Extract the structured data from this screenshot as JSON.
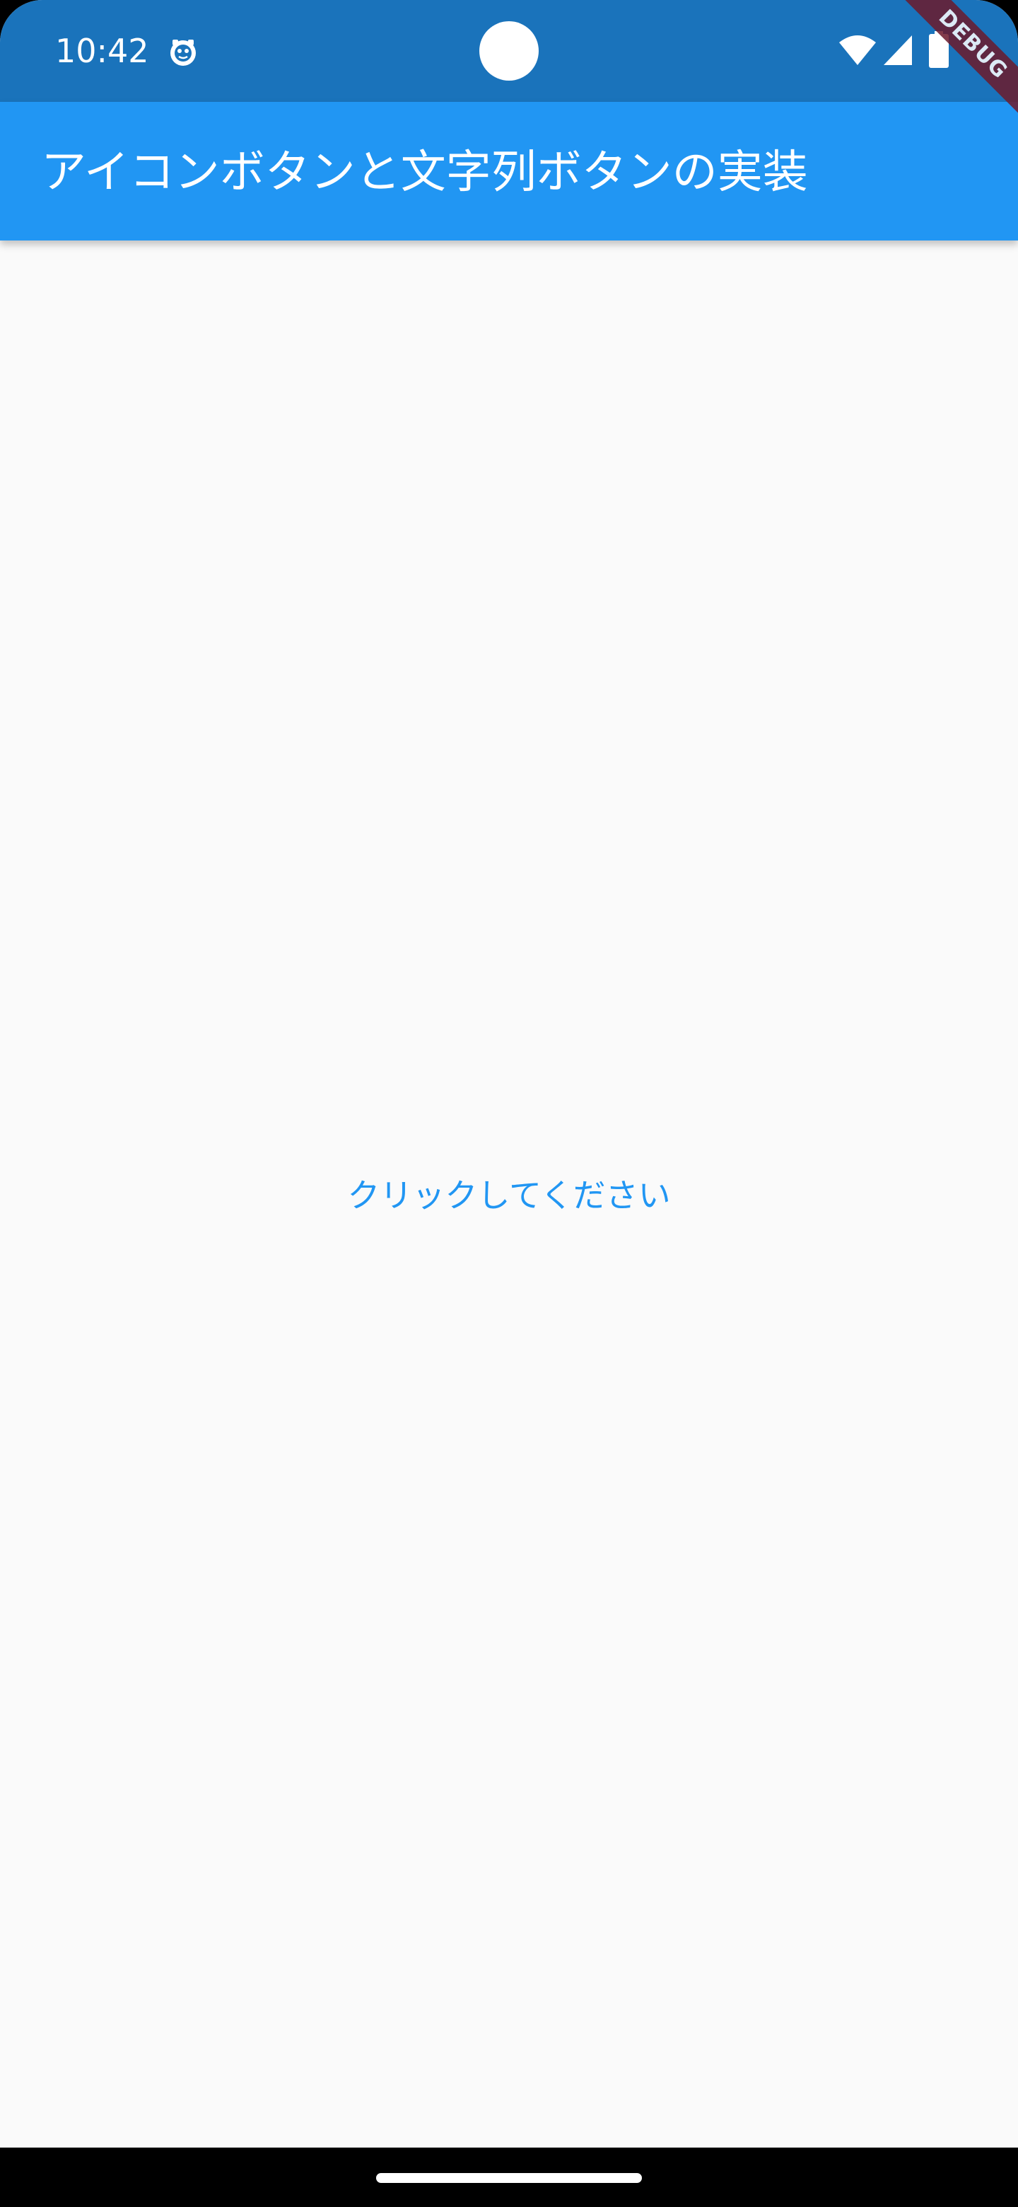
{
  "status_bar": {
    "time": "10:42",
    "icons": [
      "app-notification-icon",
      "wifi-icon",
      "cellular-signal-icon",
      "battery-icon"
    ]
  },
  "app_bar": {
    "title": "アイコンボタンと文字列ボタンの実装"
  },
  "debug_banner": {
    "label": "DEBUG"
  },
  "main": {
    "text_button_label": "クリックしてください"
  },
  "colors": {
    "status_bar": "#1a73bb",
    "app_bar": "#2196f3",
    "background": "#fafafa",
    "button_text": "#2196f3",
    "debug_banner": "#6d1b2c"
  }
}
